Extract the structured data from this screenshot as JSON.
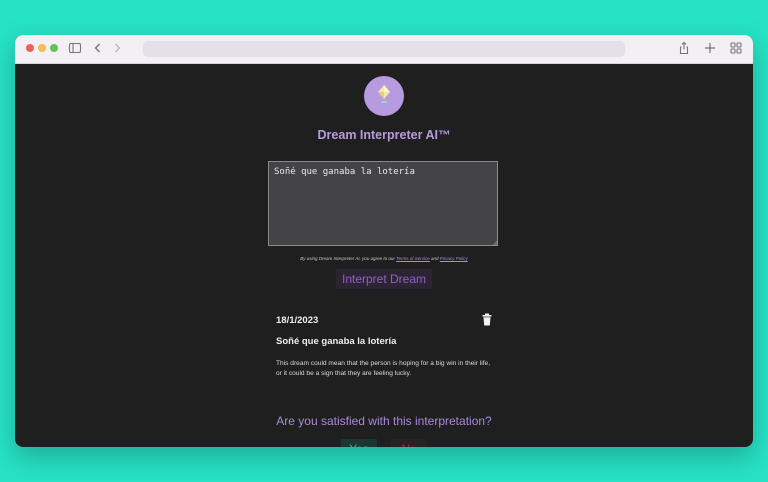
{
  "browser": {
    "url": ""
  },
  "app": {
    "title": "Dream Interpreter AI™",
    "accent_color": "#b79ae0"
  },
  "form": {
    "dream_value": "Soñé que ganaba la lotería",
    "terms_prefix": "By using Dream Interpreter AI, you agree to our",
    "terms_link": "Terms of Service",
    "terms_and": "and",
    "privacy_link": "Privacy Policy",
    "submit_label": "Interpret Dream"
  },
  "entry": {
    "date": "18/1/2023",
    "title": "Soñé que ganaba la lotería",
    "interpretation": "This dream could mean that the person is hoping for a big win in their life, or it could be a sign that they are feeling lucky."
  },
  "feedback": {
    "question": "Are you satisfied with this interpretation?",
    "yes_label": "Yes",
    "no_label": "No"
  },
  "icons": {
    "logo": "diamond-gem-icon",
    "delete": "trash-icon"
  }
}
